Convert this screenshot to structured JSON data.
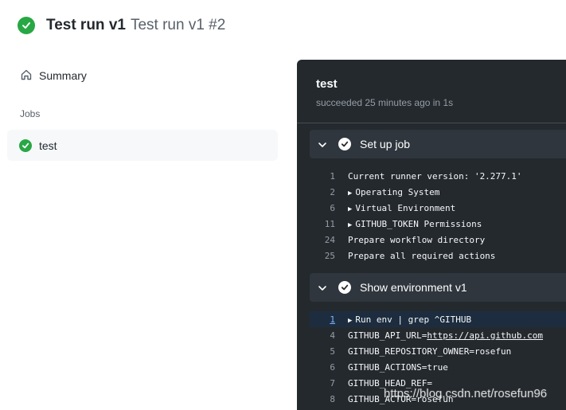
{
  "header": {
    "title_strong": "Test run v1",
    "title_sub": "Test run v1 #2",
    "status_icon": "check-circle-icon"
  },
  "sidebar": {
    "summary_label": "Summary",
    "summary_icon": "home-icon",
    "jobs_heading": "Jobs",
    "jobs": [
      {
        "label": "test",
        "status_icon": "check-circle-icon"
      }
    ]
  },
  "job": {
    "title": "test",
    "status": "succeeded 25 minutes ago in 1s",
    "steps": [
      {
        "name": "Set up job",
        "lines": [
          {
            "num": "1",
            "text": "Current runner version: '2.277.1'"
          },
          {
            "num": "2",
            "text": "Operating System",
            "collapsed": true
          },
          {
            "num": "6",
            "text": "Virtual Environment",
            "collapsed": true
          },
          {
            "num": "11",
            "text": "GITHUB_TOKEN Permissions",
            "collapsed": true
          },
          {
            "num": "24",
            "text": "Prepare workflow directory"
          },
          {
            "num": "25",
            "text": "Prepare all required actions"
          }
        ]
      },
      {
        "name": "Show environment v1",
        "lines": [
          {
            "num": "1",
            "text": "Run env | grep ^GITHUB",
            "collapsed": true,
            "highlighted": true
          },
          {
            "num": "4",
            "text_prefix": "GITHUB_API_URL=",
            "link": "https://api.github.com"
          },
          {
            "num": "5",
            "text": "GITHUB_REPOSITORY_OWNER=rosefun"
          },
          {
            "num": "6",
            "text": "GITHUB_ACTIONS=true"
          },
          {
            "num": "7",
            "text": "GITHUB_HEAD_REF="
          },
          {
            "num": "8",
            "text": "GITHUB_ACTOR=rosefun"
          }
        ]
      }
    ]
  },
  "watermark": "https://blog.csdn.net/rosefun96",
  "colors": {
    "success": "#28a745",
    "log_bg": "#24292e",
    "step_bg": "#2f363d",
    "highlight": "#1d2d3f"
  }
}
